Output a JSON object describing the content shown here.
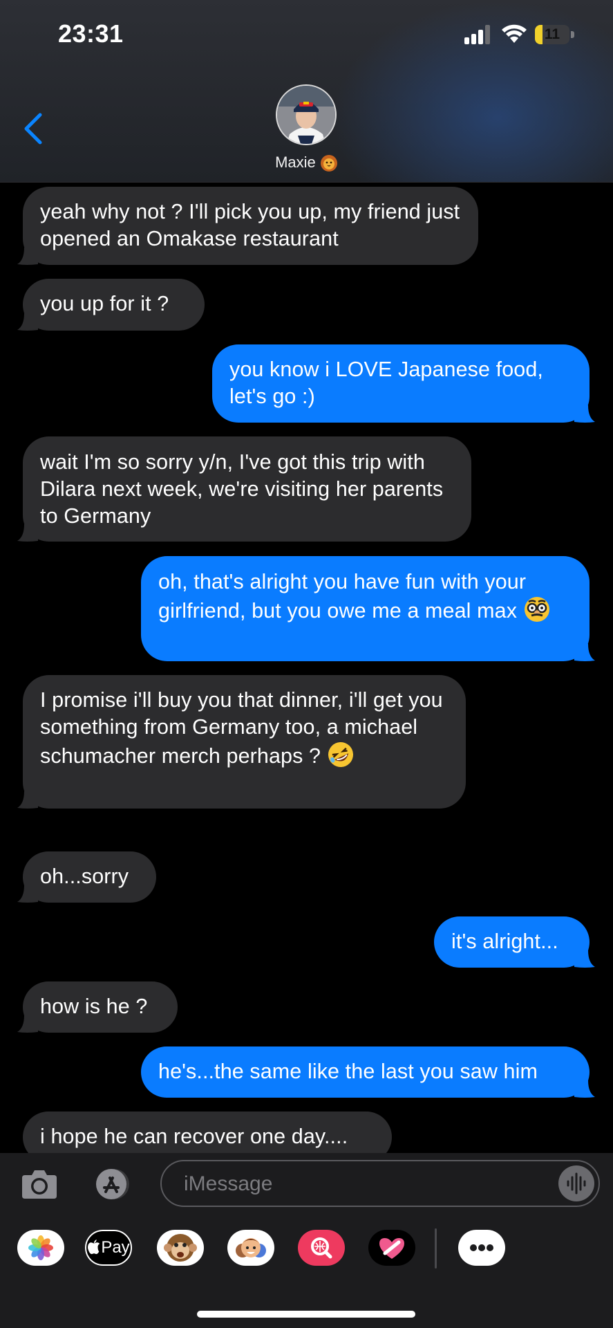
{
  "status_bar": {
    "time": "23:31",
    "battery": "11"
  },
  "header": {
    "contact_name": "Maxie"
  },
  "messages": [
    {
      "dir": "recv",
      "text": "yeah why not ? I'll pick you up, my friend just opened an Omakase restaurant"
    },
    {
      "dir": "recv",
      "text": "you up for it ?"
    },
    {
      "dir": "sent",
      "text": "you know i LOVE Japanese food, let's go :)"
    },
    {
      "dir": "recv",
      "text": "wait I'm so sorry y/n, I've got this trip with Dilara next week, we're visiting her parents to Germany"
    },
    {
      "dir": "sent",
      "text": "oh, that's alright you have fun with your girlfriend, but you owe me a meal max",
      "emoji": "disguised-face"
    },
    {
      "dir": "recv",
      "text": "I promise i'll buy you that dinner, i'll get you something from Germany too, a michael schumacher merch perhaps ?",
      "emoji": "rolling-on-floor-laughing"
    },
    {
      "dir": "recv",
      "text": "oh...sorry"
    },
    {
      "dir": "sent",
      "text": "it's alright..."
    },
    {
      "dir": "recv",
      "text": "how is he ?"
    },
    {
      "dir": "sent",
      "text": "he's...the same like the last you saw him"
    },
    {
      "dir": "recv",
      "text": "i hope he can recover one day...."
    }
  ],
  "composer": {
    "placeholder": "iMessage"
  },
  "app_strip": {
    "apple_pay_label": "Pay",
    "apps": [
      "photos-icon",
      "apple-pay-icon",
      "monkey-memoji-icon",
      "memoji-icon",
      "image-search-icon",
      "digital-touch-icon",
      "more-apps-icon"
    ]
  },
  "colors": {
    "sent_bubble": "#0a7cff",
    "received_bubble": "#2c2c2e",
    "accent": "#0a84ff",
    "background": "#000000"
  }
}
